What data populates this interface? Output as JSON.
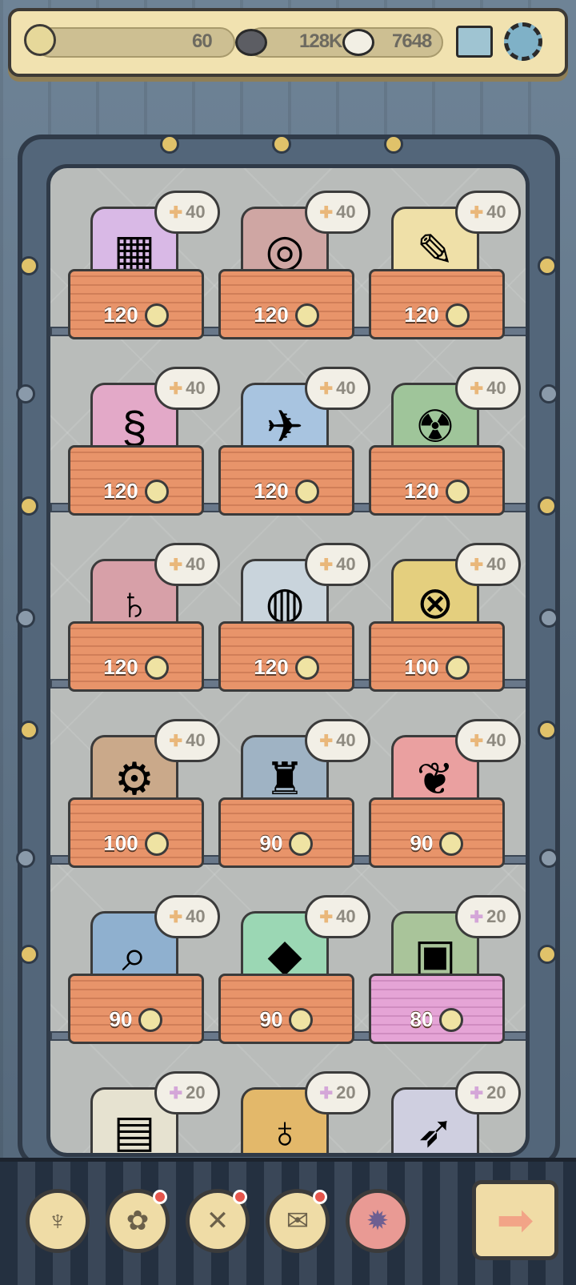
{
  "top_bar": {
    "coins": "60",
    "dark_bubbles": "128K",
    "light_bubbles": "7648"
  },
  "icons": {
    "coin": "coin-stack-icon",
    "dark_bubble": "dark-bubble-icon",
    "light_bubble": "light-bubble-icon",
    "mail": "mail-icon",
    "settings": "gear-icon",
    "puzzle": "puzzle-piece-icon"
  },
  "items": [
    {
      "id": "cube-sculpture",
      "price": "120",
      "reward": "40",
      "plank": "orange",
      "color": "#d9b9e6",
      "glyph": "▦"
    },
    {
      "id": "portal-ring",
      "price": "120",
      "reward": "40",
      "plank": "orange",
      "color": "#cfa6a3",
      "glyph": "◎"
    },
    {
      "id": "blueprint-scroll",
      "price": "120",
      "reward": "40",
      "plank": "orange",
      "color": "#efe0a8",
      "glyph": "✎"
    },
    {
      "id": "dna-helix",
      "price": "120",
      "reward": "40",
      "plank": "orange",
      "color": "#e3a9c8",
      "glyph": "§"
    },
    {
      "id": "satellite",
      "price": "120",
      "reward": "40",
      "plank": "orange",
      "color": "#a8c4e0",
      "glyph": "✈"
    },
    {
      "id": "nuclear-barrel",
      "price": "120",
      "reward": "40",
      "plank": "orange",
      "color": "#9fc59a",
      "glyph": "☢"
    },
    {
      "id": "saturn-globe",
      "price": "120",
      "reward": "40",
      "plank": "orange",
      "color": "#d7a0a8",
      "glyph": "♄"
    },
    {
      "id": "geodesic-sphere",
      "price": "120",
      "reward": "40",
      "plank": "orange",
      "color": "#c9d4dc",
      "glyph": "◍"
    },
    {
      "id": "brass-gyroscope",
      "price": "100",
      "reward": "40",
      "plank": "orange",
      "color": "#e4cf7e",
      "glyph": "⊗"
    },
    {
      "id": "steam-machine",
      "price": "100",
      "reward": "40",
      "plank": "orange",
      "color": "#caa98a",
      "glyph": "⚙"
    },
    {
      "id": "robot",
      "price": "90",
      "reward": "40",
      "plank": "orange",
      "color": "#9fb3c4",
      "glyph": "♜"
    },
    {
      "id": "brain",
      "price": "90",
      "reward": "40",
      "plank": "orange",
      "color": "#eaa0a0",
      "glyph": "❦"
    },
    {
      "id": "telescope",
      "price": "90",
      "reward": "40",
      "plank": "orange",
      "color": "#8fb0cf",
      "glyph": "⌕"
    },
    {
      "id": "green-crystal",
      "price": "90",
      "reward": "40",
      "plank": "orange",
      "color": "#9bd7b4",
      "glyph": "◆"
    },
    {
      "id": "circuit-case",
      "price": "80",
      "reward": "20",
      "plank": "pink",
      "color": "#a9c49a",
      "glyph": "▣"
    },
    {
      "id": "machine-part",
      "price": "",
      "reward": "20",
      "plank": "none",
      "color": "#e6e2d0",
      "glyph": "▤"
    },
    {
      "id": "spring-planet",
      "price": "",
      "reward": "20",
      "plank": "none",
      "color": "#e3b86a",
      "glyph": "♁"
    },
    {
      "id": "rocket-probe",
      "price": "",
      "reward": "20",
      "plank": "none",
      "color": "#cfcfe0",
      "glyph": "➶"
    }
  ],
  "nav": [
    {
      "id": "trophy",
      "icon": "trophy-icon",
      "glyph": "♆",
      "badge": false,
      "active": false
    },
    {
      "id": "rose",
      "icon": "rose-icon",
      "glyph": "✿",
      "badge": true,
      "active": false
    },
    {
      "id": "tools",
      "icon": "crossed-tools-icon",
      "glyph": "✕",
      "badge": true,
      "active": false
    },
    {
      "id": "scroll",
      "icon": "scroll-icon",
      "glyph": "✉",
      "badge": true,
      "active": false
    },
    {
      "id": "gear",
      "icon": "gear-icon",
      "glyph": "✹",
      "badge": false,
      "active": true
    }
  ],
  "next_button": {
    "icon": "arrow-right-icon",
    "glyph": "➡"
  }
}
